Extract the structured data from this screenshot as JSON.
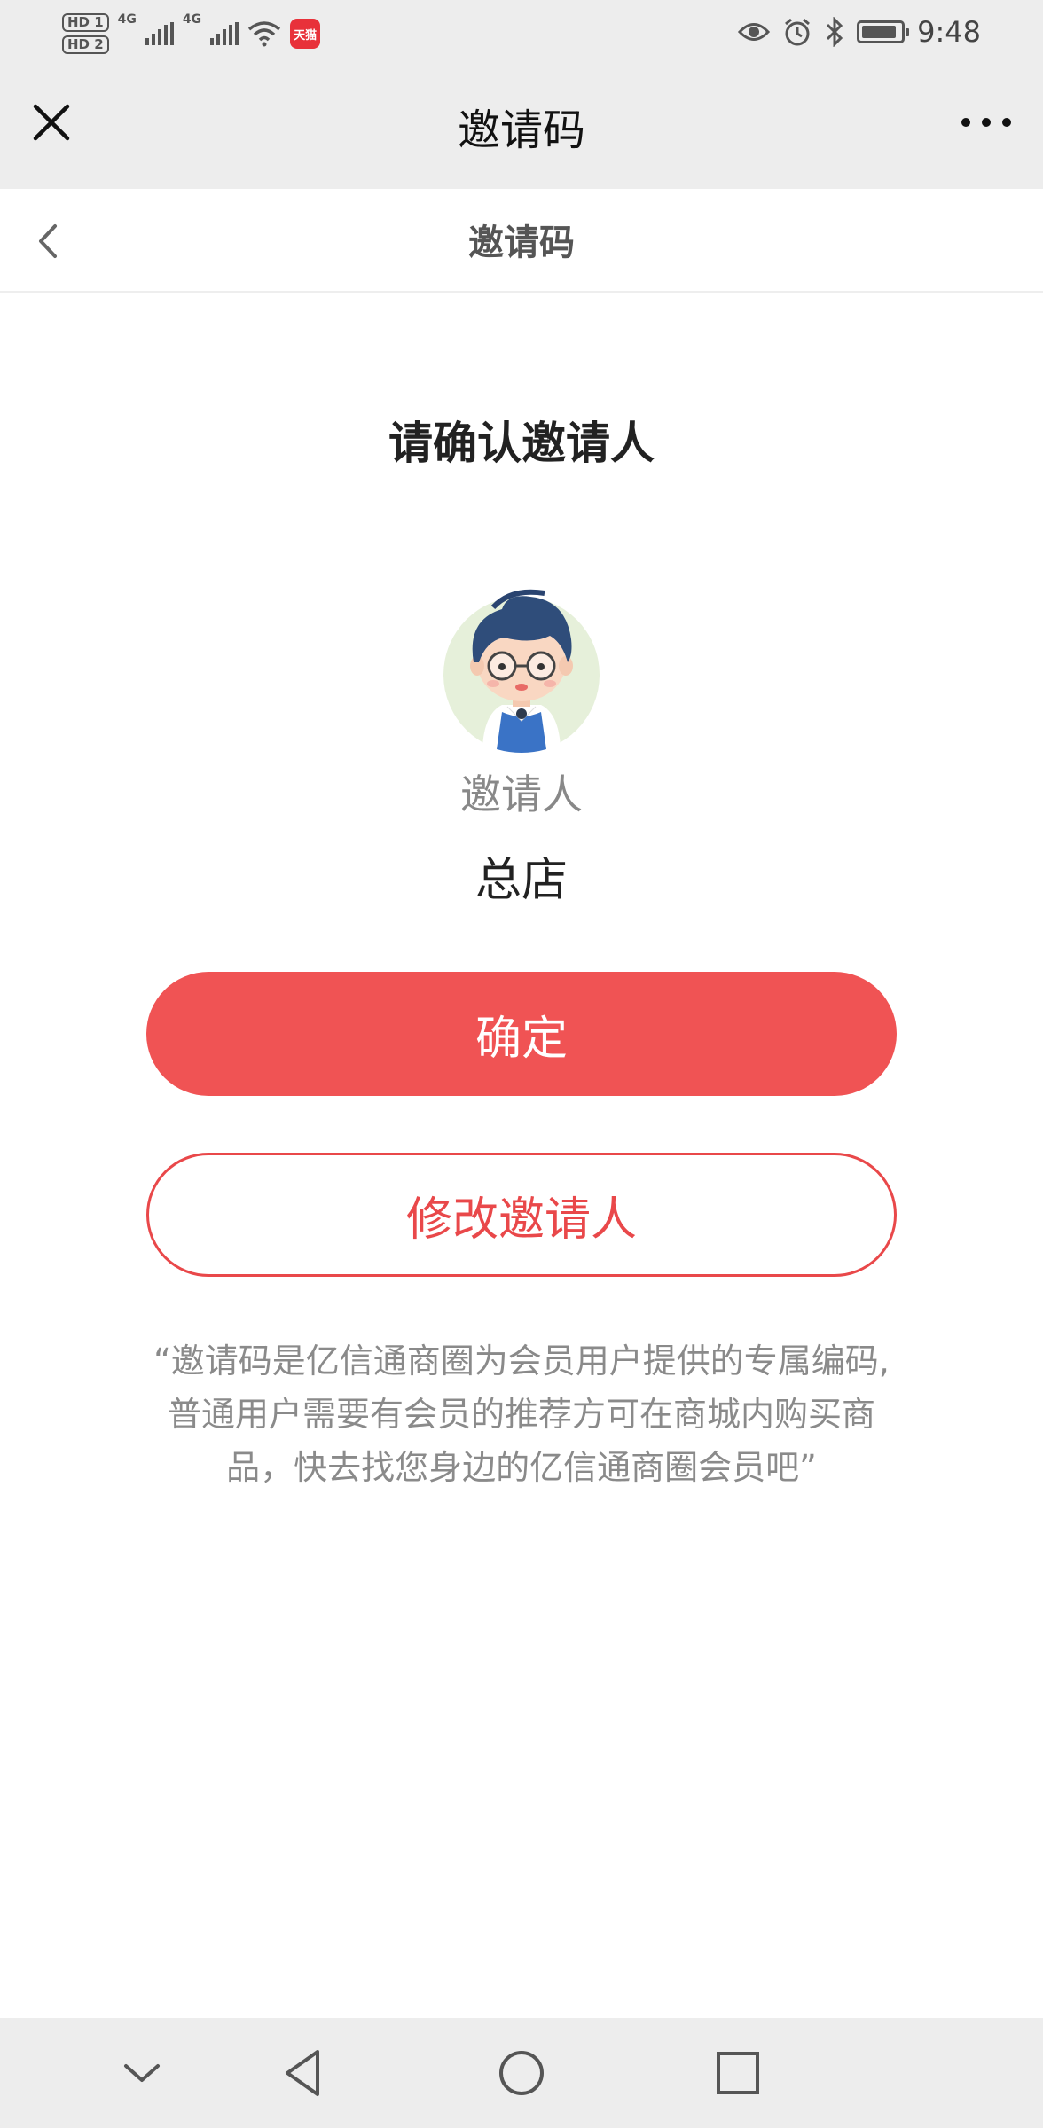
{
  "status_bar": {
    "left": {
      "hd_badges": [
        "HD 1",
        "HD 2"
      ],
      "network_types": [
        "4G",
        "4G"
      ],
      "icons": [
        "signal-icon",
        "signal-icon",
        "wifi-icon",
        "app-notification-icon"
      ],
      "app_badge_text": "天猫"
    },
    "right": {
      "icons": [
        "eye-icon",
        "alarm-icon",
        "bluetooth-icon",
        "battery-icon"
      ],
      "battery_level": 0.9,
      "time": "9:48"
    }
  },
  "webview_bar": {
    "close_icon": "close-icon",
    "title": "邀请码",
    "more_icon": "more-icon"
  },
  "nav_bar": {
    "back_icon": "chevron-left-icon",
    "title": "邀请码"
  },
  "main": {
    "heading": "请确认邀请人",
    "avatar_icon": "avatar-cartoon-boy",
    "inviter_label": "邀请人",
    "inviter_name": "总店",
    "confirm_label": "确定",
    "modify_label": "修改邀请人",
    "note": "“邀请码是亿信通商圈为会员用户提供的专属编码,普通用户需要有会员的推荐方可在商城内购买商品，快去找您身边的亿信通商圈会员吧”"
  },
  "colors": {
    "accent": "#f05354",
    "outline": "#e9484a",
    "bar_bg": "#ededed",
    "muted_text": "#8a8a8a"
  },
  "system_nav": {
    "icons": [
      "chevron-down-icon",
      "back-triangle-icon",
      "home-circle-icon",
      "recents-square-icon"
    ]
  }
}
